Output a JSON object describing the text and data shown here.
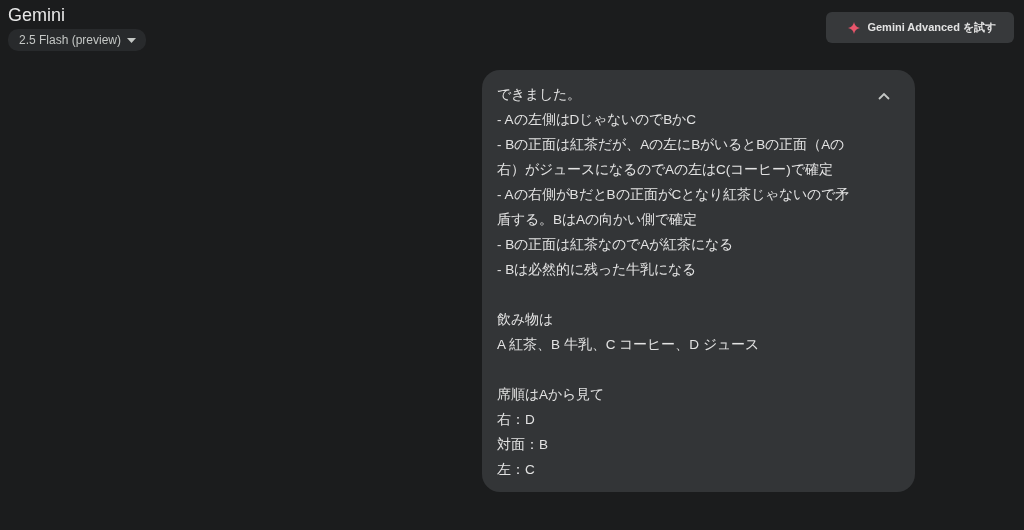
{
  "header": {
    "title": "Gemini",
    "model_selector": {
      "label": "2.5 Flash (preview)"
    },
    "upgrade_button": {
      "label": "Gemini Advanced を試す"
    }
  },
  "message": {
    "expanded": true,
    "paragraphs": [
      {
        "lines": [
          "できました。",
          "- Aの左側はDじゃないのでBかC",
          "- Bの正面は紅茶だが、Aの左にBがいるとBの正面（Aの",
          "右）がジュースになるのでAの左はC(コーヒー)で確定",
          "- Aの右側がBだとBの正面がCとなり紅茶じゃないので矛",
          "盾する。BはAの向かい側で確定",
          "- Bの正面は紅茶なのでAが紅茶になる",
          "- Bは必然的に残った牛乳になる"
        ]
      },
      {
        "lines": [
          "飲み物は",
          "A 紅茶、B 牛乳、C コーヒー、D ジュース"
        ]
      },
      {
        "lines": [
          "席順はAから見て",
          "右：D",
          "対面：B",
          "左：C"
        ]
      }
    ]
  }
}
